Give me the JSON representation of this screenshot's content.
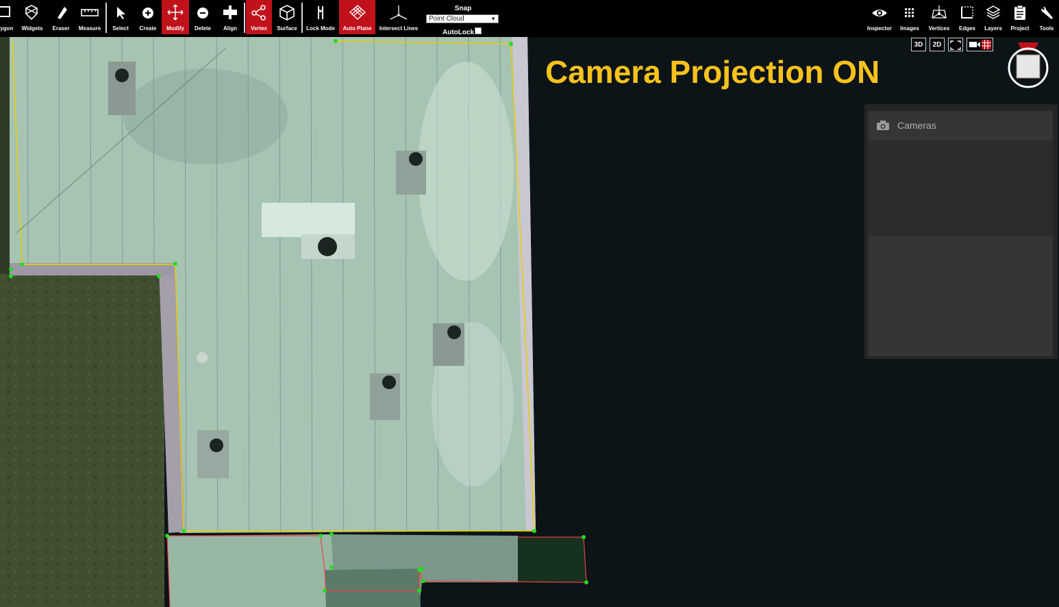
{
  "toolbar": {
    "tools": [
      {
        "id": "polygon",
        "label": "lygon",
        "icon": "polygon-icon"
      },
      {
        "id": "widgets",
        "label": "Widgets",
        "icon": "widgets-icon"
      },
      {
        "id": "eraser",
        "label": "Eraser",
        "icon": "eraser-icon"
      },
      {
        "id": "measure",
        "label": "Measure",
        "icon": "ruler-icon"
      },
      {
        "id": "select",
        "label": "Select",
        "icon": "select-cursor-icon"
      },
      {
        "id": "create",
        "label": "Create",
        "icon": "create-plus-icon"
      },
      {
        "id": "modify",
        "label": "Modify",
        "icon": "move-arrows-icon",
        "active": true
      },
      {
        "id": "delete",
        "label": "Delete",
        "icon": "delete-minus-icon"
      },
      {
        "id": "align",
        "label": "Align",
        "icon": "align-icon"
      },
      {
        "id": "vertex",
        "label": "Vertex",
        "icon": "vertex-share-icon",
        "active": true
      },
      {
        "id": "surface",
        "label": "Surface",
        "icon": "cube-icon"
      },
      {
        "id": "lock_mode",
        "label": "Lock Mode",
        "icon": "lock-mode-icon"
      },
      {
        "id": "auto_plane",
        "label": "Auto Plane",
        "icon": "grid-diamond-icon",
        "active": true
      },
      {
        "id": "intersect_lines",
        "label": "Intersect Lines",
        "icon": "intersect-lines-icon"
      }
    ],
    "snap": {
      "title": "Snap",
      "value": "Point Cloud",
      "arrow": "▼"
    },
    "autolock": {
      "label": "AutoLock"
    },
    "right_tools": [
      {
        "id": "inspector",
        "label": "Inspector",
        "icon": "eye-icon"
      },
      {
        "id": "images",
        "label": "Images",
        "icon": "images-grid-icon"
      },
      {
        "id": "vertices",
        "label": "Vertices",
        "icon": "vertices-icon"
      },
      {
        "id": "edges",
        "label": "Edges",
        "icon": "edges-icon"
      },
      {
        "id": "layers",
        "label": "Layers",
        "icon": "layers-icon"
      },
      {
        "id": "project",
        "label": "Project",
        "icon": "clipboard-icon"
      },
      {
        "id": "tools",
        "label": "Tools",
        "icon": "wrench-icon"
      }
    ]
  },
  "view_controls": {
    "btn_3d": "3D",
    "btn_2d": "2D"
  },
  "overlay_title": "Camera Projection ON",
  "cameras_panel": {
    "title": "Cameras",
    "icon": "camera-icon"
  },
  "colors": {
    "active": "#c1121c",
    "overlay_title": "#f8c21c",
    "edge_yellow": "#e8d000",
    "edge_red": "#e84040",
    "vertex_green": "#22dd22"
  }
}
